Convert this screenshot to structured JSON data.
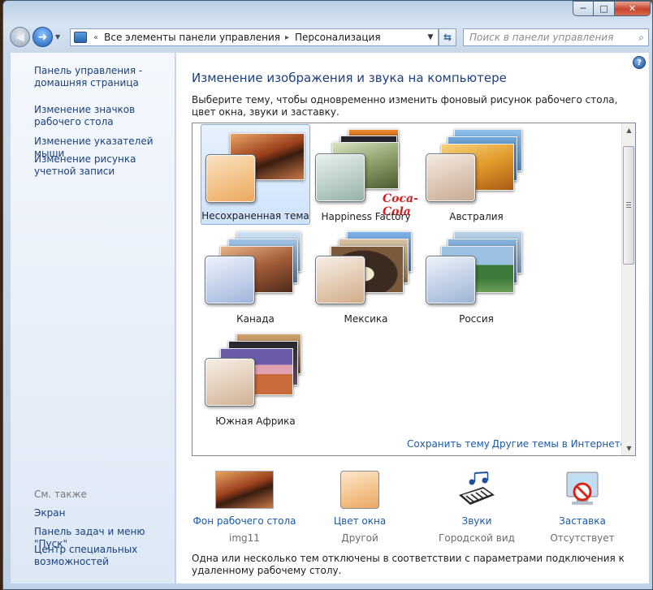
{
  "window": {
    "caption_min": "─",
    "caption_max": "□",
    "caption_close": "✕"
  },
  "nav": {
    "back_glyph": "◀",
    "forward_glyph": "➜",
    "dropdown_glyph": "▼"
  },
  "address": {
    "separator": "«",
    "crumbs": [
      "Все элементы панели управления",
      "Персонализация"
    ],
    "crumb_separator": "▸",
    "dropdown_glyph": "▼"
  },
  "refresh_glyph": "⇆",
  "search": {
    "placeholder": "Поиск в панели управления",
    "icon": "search-icon",
    "glyph": "⌕"
  },
  "sidebar": {
    "links": [
      {
        "label": "Панель управления - домашняя страница"
      },
      {
        "label": "Изменение значков рабочего стола"
      },
      {
        "label": "Изменение указателей мыши"
      },
      {
        "label": "Изменение рисунка учетной записи"
      }
    ],
    "see_also_title": "См. также",
    "see_also_links": [
      {
        "label": "Экран"
      },
      {
        "label": "Панель задач и меню \"Пуск\""
      },
      {
        "label": "Центр специальных возможностей"
      }
    ]
  },
  "main": {
    "help_glyph": "?",
    "title": "Изменение изображения и звука на компьютере",
    "description": "Выберите тему, чтобы одновременно изменить фоновый рисунок рабочего стола, цвет окна, звуки и заставку.",
    "themes": [
      {
        "name": "Несохраненная тема",
        "selected": true
      },
      {
        "name": "Happiness Factory",
        "selected": false
      },
      {
        "name": "Австралия",
        "selected": false
      },
      {
        "name": "Канада",
        "selected": false
      },
      {
        "name": "Мексика",
        "selected": false
      },
      {
        "name": "Россия",
        "selected": false
      },
      {
        "name": "Южная Африка",
        "selected": false
      }
    ],
    "coca_cola_logo": "Coca-Cola",
    "scroll_up_glyph": "▲",
    "scroll_down_glyph": "▼",
    "save_theme_link": "Сохранить тему",
    "more_themes_link": "Другие темы в Интернете",
    "options": [
      {
        "label": "Фон рабочего стола",
        "value": "img11",
        "icon": "desktop-background-icon"
      },
      {
        "label": "Цвет окна",
        "value": "Другой",
        "icon": "window-color-icon"
      },
      {
        "label": "Звуки",
        "value": "Городской вид",
        "icon": "sounds-icon"
      },
      {
        "label": "Заставка",
        "value": "Отсутствует",
        "icon": "screensaver-icon"
      }
    ],
    "note": "Одна или несколько тем отключены в соответствии с параметрами подключения к удаленному рабочему столу."
  },
  "colors": {
    "link": "#1a5aa8",
    "title": "#1e3f7e",
    "sidebar_link": "#1a3f7b",
    "selection": "#cfe3fb"
  }
}
